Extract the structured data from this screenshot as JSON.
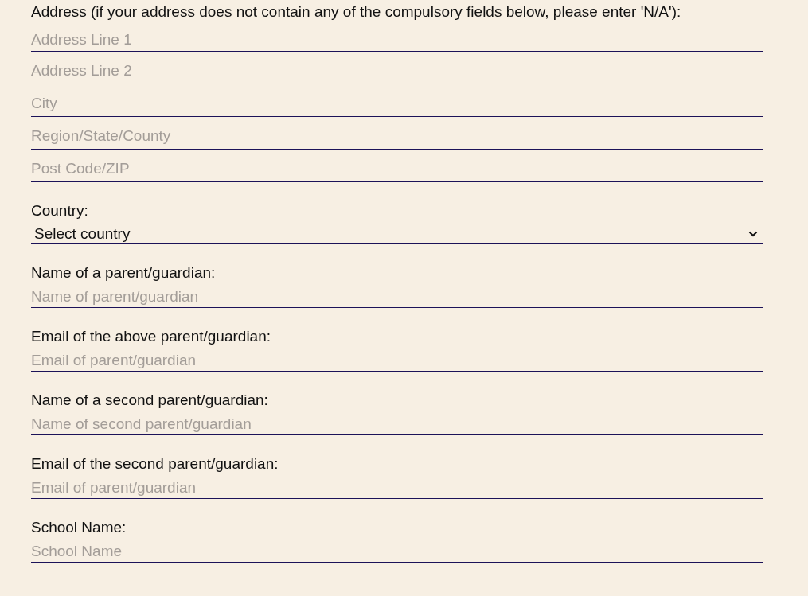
{
  "address": {
    "label": "Address (if your address does not contain any of the compulsory fields below, please enter 'N/A'):",
    "fields": [
      {
        "placeholder": "Address Line 1"
      },
      {
        "placeholder": "Address Line 2"
      },
      {
        "placeholder": "City"
      },
      {
        "placeholder": "Region/State/County"
      },
      {
        "placeholder": "Post Code/ZIP"
      }
    ]
  },
  "country": {
    "label": "Country:",
    "value": "Select country"
  },
  "fields": [
    {
      "label": "Name of a parent/guardian:",
      "placeholder": "Name of parent/guardian"
    },
    {
      "label": "Email of the above parent/guardian:",
      "placeholder": "Email of parent/guardian"
    },
    {
      "label": "Name of a second parent/guardian:",
      "placeholder": "Name of second parent/guardian"
    },
    {
      "label": "Email of the second parent/guardian:",
      "placeholder": "Email of parent/guardian"
    },
    {
      "label": "School Name:",
      "placeholder": "School Name"
    }
  ]
}
